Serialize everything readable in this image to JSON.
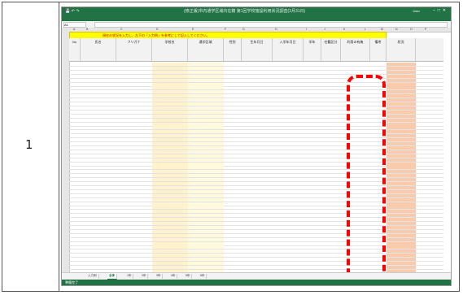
{
  "row_number": "1",
  "excel": {
    "title": "(修正版)市内通学区域内在籍 第1回学校施設利用状況調査(3月31日)",
    "user": "User",
    "ribbon_tabs": [
      "ファイル",
      "ホーム",
      "挿入",
      "ページレイアウト",
      "数式",
      "データ",
      "校閲",
      "表示",
      "ヘルプ"
    ],
    "name_box": "A1",
    "banner": "現在の状況を入力し、左下の「入力例」を参考にして記入してください。",
    "col_letters": [
      "A",
      "B",
      "C",
      "D",
      "E",
      "F",
      "G",
      "H",
      "I",
      "J",
      "K",
      "L",
      "M",
      "N",
      "O",
      "P"
    ],
    "headers": [
      "No",
      "氏名",
      "フリガナ",
      "学校名",
      "通学区域",
      "性別",
      "生年月日",
      "入学年月日",
      "学年",
      "在籍区分",
      "利用の有無",
      "備考",
      "状況"
    ],
    "sheet_tabs": [
      "入力例",
      "全体",
      "1年",
      "2年",
      "3年",
      "4年",
      "5年",
      "6年"
    ],
    "active_tab": "全体",
    "status": "準備完了"
  },
  "colors": {
    "excel_green": "#217346",
    "banner_yellow": "#ffff00",
    "highlight_red": "#ff0000",
    "orange_fill": "#f8cbad"
  }
}
